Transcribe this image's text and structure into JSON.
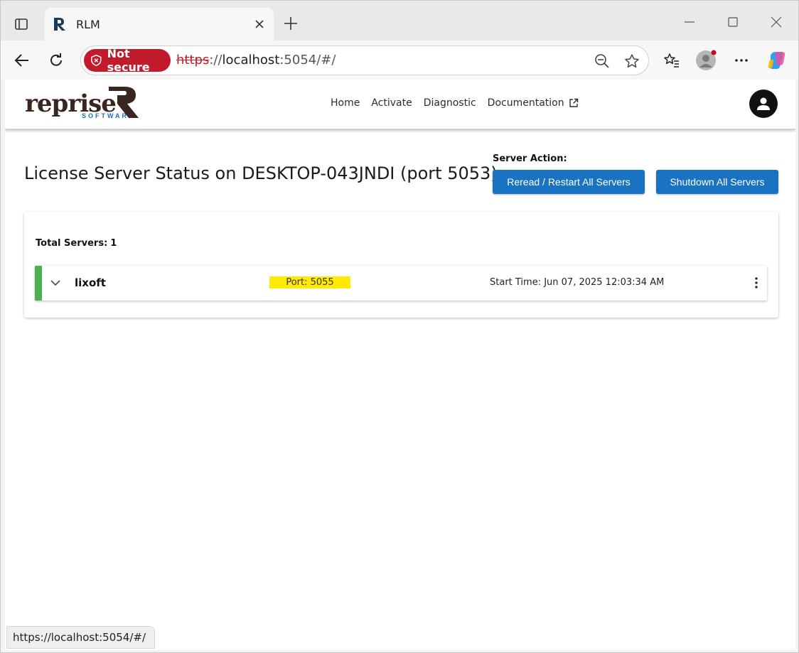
{
  "browser": {
    "tab": {
      "title": "RLM"
    },
    "address": {
      "security_label": "Not secure",
      "url_scheme": "https",
      "url_sep": "://",
      "url_host": "localhost",
      "url_rest": ":5054/#/"
    },
    "status_url": "https://localhost:5054/#/"
  },
  "app": {
    "logo": {
      "text": "reprise",
      "subtitle": "SOFTWARE"
    },
    "nav": {
      "home": "Home",
      "activate": "Activate",
      "diagnostic": "Diagnostic",
      "documentation": "Documentation"
    },
    "title": "License Server Status on DESKTOP-043JNDI (port 5053)",
    "server_action_label": "Server Action:",
    "actions": {
      "reread": "Reread / Restart All Servers",
      "shutdown": "Shutdown All Servers"
    },
    "servers": {
      "total_label": "Total Servers:",
      "total_value": "1",
      "rows": [
        {
          "name": "lixoft",
          "port": "Port: 5055",
          "start_time": "Start Time: Jun 07, 2025 12:03:34 AM",
          "status_color": "#4caf50"
        }
      ]
    }
  },
  "colors": {
    "accent": "#1a73c2",
    "insecure": "#c21b2c",
    "highlight": "#ffea00",
    "status_ok": "#4caf50"
  }
}
